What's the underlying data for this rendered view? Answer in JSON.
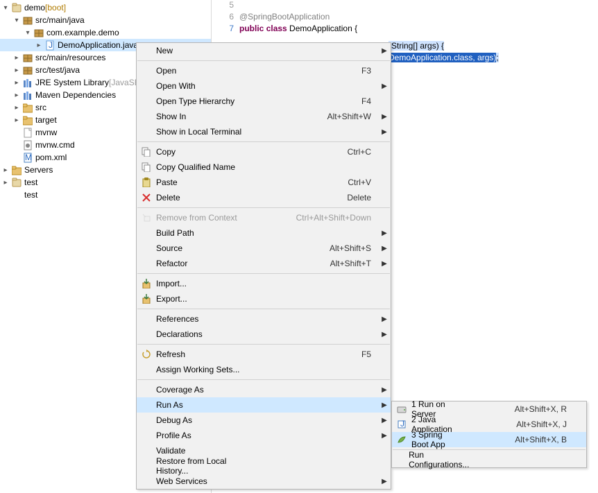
{
  "tree": {
    "project": {
      "label": "demo",
      "decor": " [boot]"
    },
    "srcMainJava": "src/main/java",
    "pkg": "com.example.demo",
    "appFile": "DemoApplication.java",
    "srcMainRes": "src/main/resources",
    "srcTestJava": "src/test/java",
    "jre": {
      "label": "JRE System Library",
      "qual": " [JavaSE"
    },
    "maven": "Maven Dependencies",
    "src": "src",
    "target": "target",
    "mvnw": "mvnw",
    "mvnwCmd": "mvnw.cmd",
    "pom": "pom.xml",
    "servers": "Servers",
    "testProj": "test",
    "testLoose": "test"
  },
  "code": {
    "l5": "5",
    "l6": "6",
    "annotation": "@SpringBootApplication",
    "l7": "7",
    "public": "public",
    "class": "class",
    "clsname": " DemoApplication {",
    "l9a": "(",
    "l9b": "tring[] args) {",
    "l10a": "DemoApplication.",
    "l10b": "class",
    "l10c": ", args)",
    "l10d": ";"
  },
  "ctx": {
    "new": "New",
    "open": "Open",
    "openK": "F3",
    "openWith": "Open With",
    "openType": "Open Type Hierarchy",
    "openTypeK": "F4",
    "showIn": "Show In",
    "showInK": "Alt+Shift+W",
    "showTerm": "Show in Local Terminal",
    "copy": "Copy",
    "copyK": "Ctrl+C",
    "copyQual": "Copy Qualified Name",
    "paste": "Paste",
    "pasteK": "Ctrl+V",
    "delete": "Delete",
    "deleteK": "Delete",
    "removeCtx": "Remove from Context",
    "removeCtxK": "Ctrl+Alt+Shift+Down",
    "buildPath": "Build Path",
    "source": "Source",
    "sourceK": "Alt+Shift+S",
    "refactor": "Refactor",
    "refactorK": "Alt+Shift+T",
    "import": "Import...",
    "export": "Export...",
    "references": "References",
    "declarations": "Declarations",
    "refresh": "Refresh",
    "refreshK": "F5",
    "assign": "Assign Working Sets...",
    "coverage": "Coverage As",
    "runAs": "Run As",
    "debugAs": "Debug As",
    "profileAs": "Profile As",
    "validate": "Validate",
    "restore": "Restore from Local History...",
    "webSvc": "Web Services"
  },
  "sub": {
    "runServer": "1 Run on Server",
    "runServerK": "Alt+Shift+X, R",
    "javaApp": "2 Java Application",
    "javaAppK": "Alt+Shift+X, J",
    "springApp": "3 Spring Boot App",
    "springAppK": "Alt+Shift+X, B",
    "runConfig": "Run Configurations..."
  }
}
